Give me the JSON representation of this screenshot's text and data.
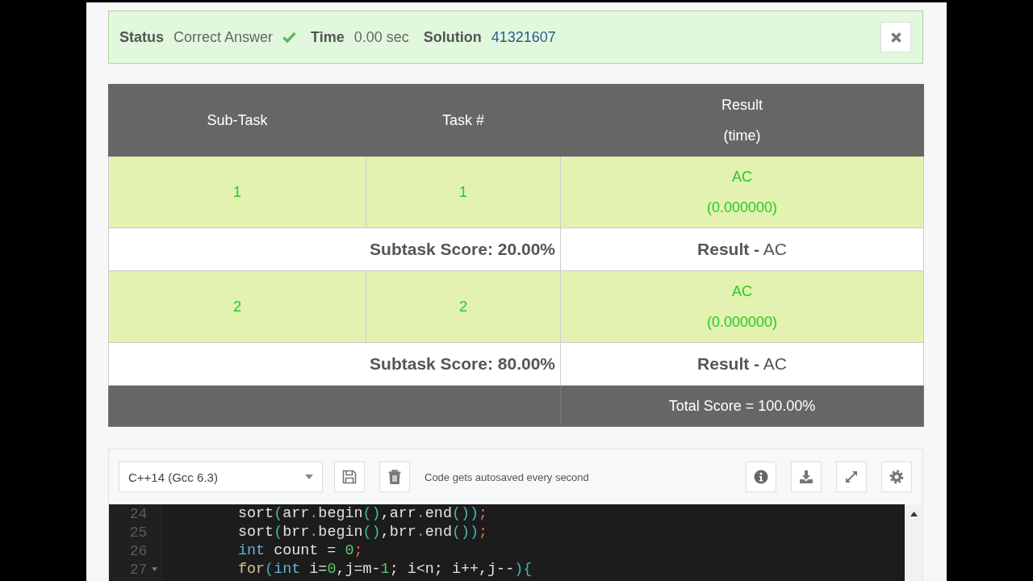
{
  "status_bar": {
    "items": [
      {
        "label": "Status",
        "value": "Correct Answer",
        "kind": "verdict"
      },
      {
        "label": "Time",
        "value": "0.00 sec",
        "kind": "plain"
      },
      {
        "label": "Solution",
        "value": "41321607",
        "kind": "link"
      }
    ],
    "dismissible": true
  },
  "table": {
    "columns": [
      {
        "label": "Sub-Task"
      },
      {
        "label": "Task #"
      },
      {
        "label": "Result",
        "note": "(time)"
      }
    ],
    "subtasks": [
      {
        "subtask": "1",
        "task": "1",
        "verdict": "AC",
        "time": "(0.000000)",
        "passed": true,
        "score": "Subtask Score: 20.00%",
        "result": "**Result -** AC"
      },
      {
        "subtask": "2",
        "task": "2",
        "verdict": "AC",
        "time": "(0.000000)",
        "passed": true,
        "score": "Subtask Score: 80.00%",
        "result": "**Result -** AC"
      }
    ],
    "total": "Total Score = 100.00%"
  },
  "editor": {
    "language": "C++14 (Gcc 6.3)",
    "autosave_note": "Code gets autosaved every second",
    "lines": [
      {
        "number": "24",
        "foldable": false,
        "tokens": [
          {
            "text": "sort",
            "kind": "plain"
          },
          {
            "text": "(",
            "kind": "paren"
          },
          {
            "text": "arr",
            "kind": "plain"
          },
          {
            "text": ".",
            "kind": "punct"
          },
          {
            "text": "begin",
            "kind": "plain"
          },
          {
            "text": "()",
            "kind": "paren"
          },
          {
            "text": ",arr",
            "kind": "plain"
          },
          {
            "text": ".",
            "kind": "punct"
          },
          {
            "text": "end",
            "kind": "plain"
          },
          {
            "text": "())",
            "kind": "paren"
          },
          {
            "text": ";",
            "kind": "punct"
          }
        ]
      },
      {
        "number": "25",
        "foldable": false,
        "tokens": [
          {
            "text": "sort",
            "kind": "plain"
          },
          {
            "text": "(",
            "kind": "paren"
          },
          {
            "text": "brr",
            "kind": "plain"
          },
          {
            "text": ".",
            "kind": "punct"
          },
          {
            "text": "begin",
            "kind": "plain"
          },
          {
            "text": "()",
            "kind": "paren"
          },
          {
            "text": ",brr",
            "kind": "plain"
          },
          {
            "text": ".",
            "kind": "punct"
          },
          {
            "text": "end",
            "kind": "plain"
          },
          {
            "text": "())",
            "kind": "paren"
          },
          {
            "text": ";",
            "kind": "punct"
          }
        ]
      },
      {
        "number": "26",
        "foldable": false,
        "tokens": [
          {
            "text": "int",
            "kind": "type"
          },
          {
            "text": " count = ",
            "kind": "plain"
          },
          {
            "text": "0",
            "kind": "number"
          },
          {
            "text": ";",
            "kind": "punct"
          }
        ]
      },
      {
        "number": "27",
        "foldable": true,
        "tokens": [
          {
            "text": "for",
            "kind": "keyword"
          },
          {
            "text": "(",
            "kind": "paren"
          },
          {
            "text": "int",
            "kind": "type"
          },
          {
            "text": " i=",
            "kind": "plain"
          },
          {
            "text": "0",
            "kind": "number"
          },
          {
            "text": ",j=m-",
            "kind": "plain"
          },
          {
            "text": "1",
            "kind": "number"
          },
          {
            "text": "; i<n; i++,j--",
            "kind": "plain"
          },
          {
            "text": "){",
            "kind": "paren"
          }
        ]
      }
    ]
  }
}
